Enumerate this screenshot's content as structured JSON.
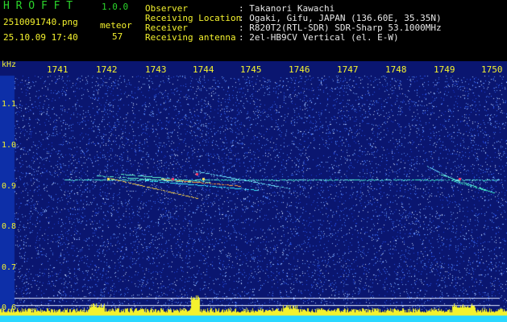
{
  "app": {
    "name": "H R O F F T",
    "version": "1.0.0"
  },
  "file": {
    "name": "2510091740.png",
    "datetime": "25.10.09 17:40"
  },
  "counter": {
    "label": "meteor",
    "value": "57"
  },
  "info": [
    {
      "label": "Observer",
      "value": ": Takanori Kawachi"
    },
    {
      "label": "Receiving Location",
      "value": ": Ogaki, Gifu, JAPAN (136.60E, 35.35N)"
    },
    {
      "label": "Receiver",
      "value": ": R820T2(RTL-SDR) SDR-Sharp 53.1000MHz"
    },
    {
      "label": "Receiving antenna",
      "value": ": 2el-HB9CV Vertical (el. E-W)"
    }
  ],
  "axis": {
    "unit": "kHz",
    "x_ticks": [
      "1741",
      "1742",
      "1743",
      "1744",
      "1745",
      "1746",
      "1747",
      "1748",
      "1749",
      "1750"
    ],
    "y_ticks": [
      "1.1",
      "1.0",
      "0.9",
      "0.8",
      "0.7",
      "0.6"
    ]
  },
  "colors": {
    "background": "#0a1670",
    "noise": "#3a6cff",
    "signal": "#37f0c8",
    "baseline": "#ffffff",
    "bottom_band": "#f4f22e",
    "bottom_edge": "#2ad8ff",
    "text_green": "#2bd52b",
    "text_yellow": "#f4f22e"
  }
}
